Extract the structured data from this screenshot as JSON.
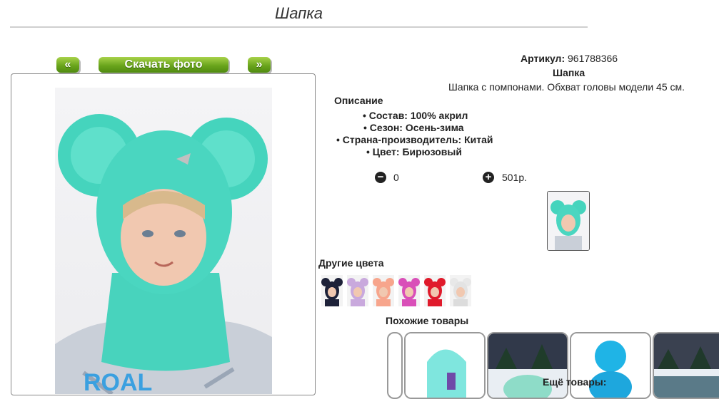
{
  "page": {
    "title": "Шапка"
  },
  "gallery": {
    "prev_label": "«",
    "download_label": "Скачать фото",
    "next_label": "»"
  },
  "product": {
    "article_label": "Артикул:",
    "article_value": "961788366",
    "name": "Шапка",
    "summary": "Шапка с помпонами. Обхват головы модели 45 см.",
    "description_heading": "Описание",
    "attributes": [
      "Состав: 100% акрил",
      "Сезон: Осень-зима",
      "Страна-производитель: Китай",
      "Цвет: Бирюзовый"
    ],
    "quantity": "0",
    "price": "501р.",
    "accent_color": "#41d6bf"
  },
  "other_colors": {
    "heading": "Другие цвета",
    "swatches": [
      {
        "color": "#1d2138",
        "name": "navy"
      },
      {
        "color": "#c9a9dd",
        "name": "lilac"
      },
      {
        "color": "#f7a58c",
        "name": "peach"
      },
      {
        "color": "#d94fb8",
        "name": "pink"
      },
      {
        "color": "#e01a2b",
        "name": "red"
      },
      {
        "color": "#f2f2f2",
        "name": "white"
      }
    ]
  },
  "similar": {
    "heading": "Похожие товары",
    "more_label": "Ещё товары:"
  },
  "icons": {
    "minus": "minus-circle-icon",
    "plus": "plus-circle-icon"
  }
}
